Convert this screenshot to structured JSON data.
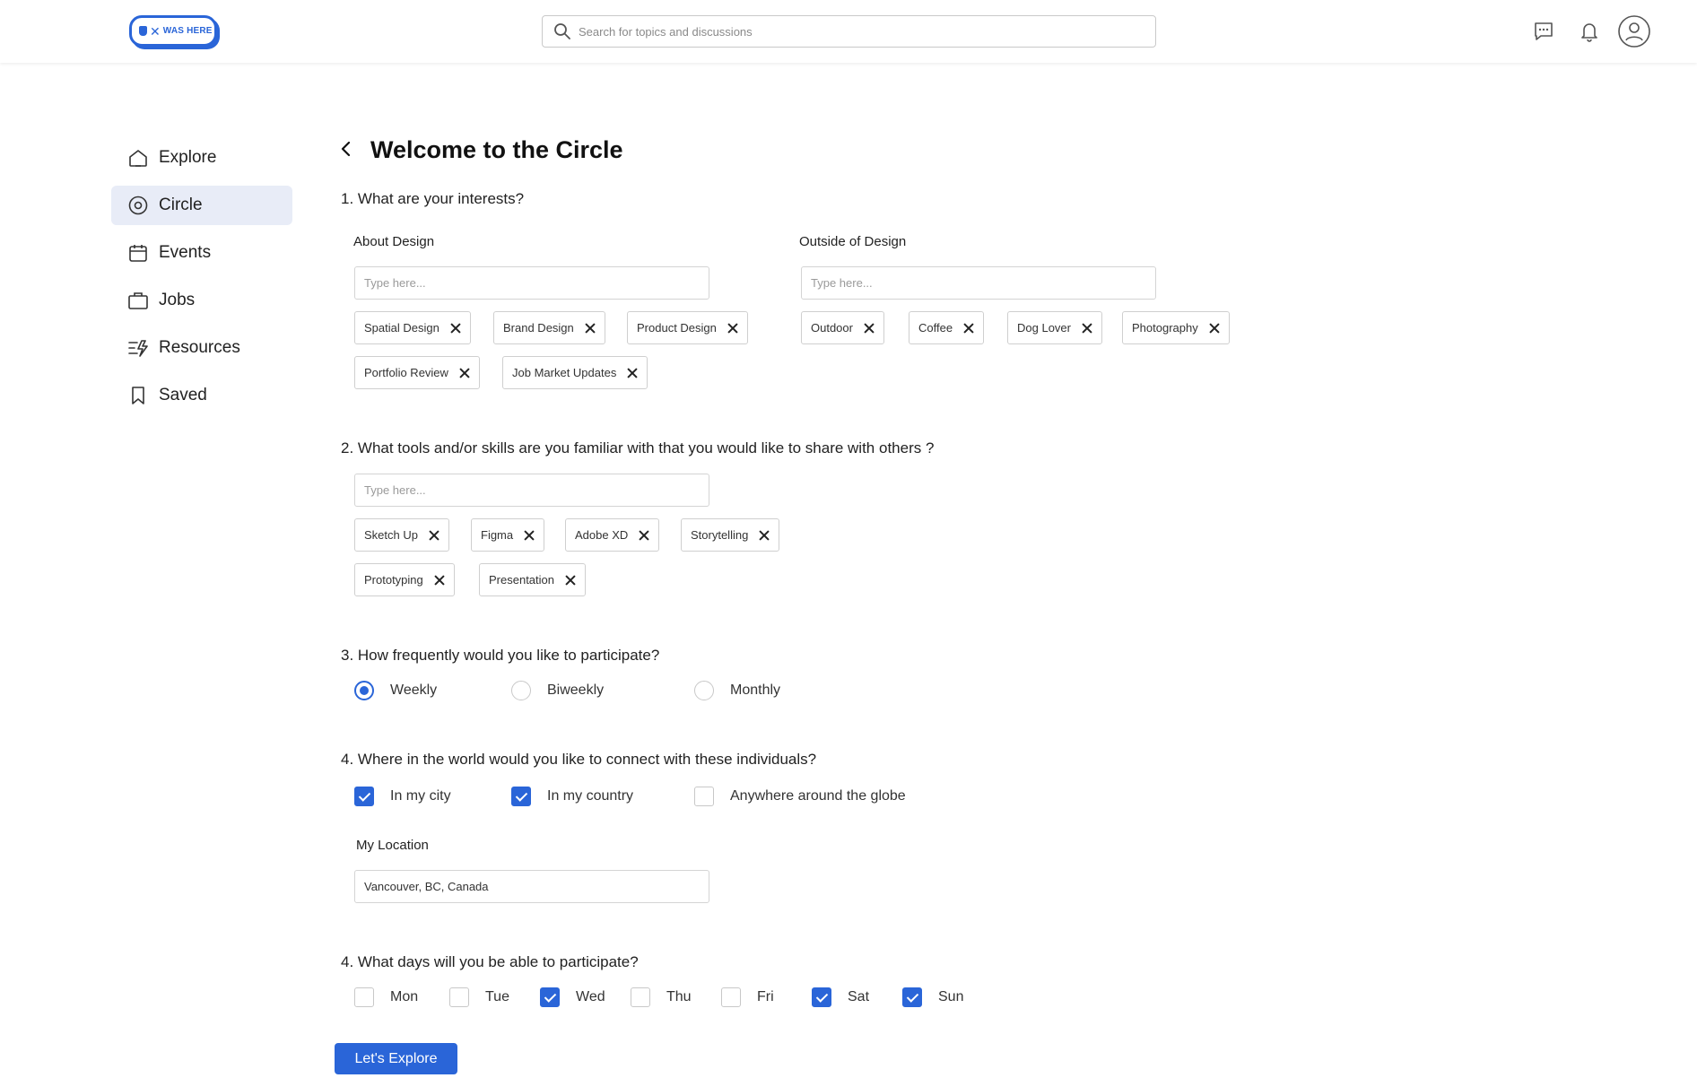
{
  "app": {
    "logo_text": "WAS HERE",
    "logo_mark": "UX",
    "accent": "#2a65d8"
  },
  "search": {
    "placeholder": "Search for topics and discussions",
    "icon": "search-icon"
  },
  "header_icons": [
    "chat-icon",
    "bell-icon",
    "user-icon"
  ],
  "sidebar": {
    "items": [
      {
        "label": "Explore",
        "icon": "home-icon",
        "active": false
      },
      {
        "label": "Circle",
        "icon": "circle-icon",
        "active": true
      },
      {
        "label": "Events",
        "icon": "calendar-icon",
        "active": false
      },
      {
        "label": "Jobs",
        "icon": "briefcase-icon",
        "active": false
      },
      {
        "label": "Resources",
        "icon": "resources-icon",
        "active": false
      },
      {
        "label": "Saved",
        "icon": "bookmark-icon",
        "active": false
      }
    ]
  },
  "page": {
    "title": "Welcome to the Circle"
  },
  "q1": {
    "question": "1. What are your interests?",
    "about": {
      "label": "About Design",
      "placeholder": "Type here...",
      "chips": [
        "Spatial Design",
        "Brand Design",
        "Product Design",
        "Portfolio Review",
        "Job Market Updates"
      ]
    },
    "outside": {
      "label": "Outside of Design",
      "placeholder": "Type here...",
      "chips": [
        "Outdoor",
        "Coffee",
        "Dog Lover",
        "Photography"
      ]
    }
  },
  "q2": {
    "question": "2. What tools and/or skills are you familiar with that you would like to share with others ?",
    "placeholder": "Type here...",
    "chips": [
      "Sketch Up",
      "Figma",
      "Adobe XD",
      "Storytelling",
      "Prototyping",
      "Presentation"
    ]
  },
  "q3": {
    "question": "3. How frequently would you like to participate?",
    "options": [
      {
        "label": "Weekly",
        "selected": true
      },
      {
        "label": "Biweekly",
        "selected": false
      },
      {
        "label": "Monthly",
        "selected": false
      }
    ]
  },
  "q4": {
    "question": "4. Where in the world would you like to connect with these individuals?",
    "options": [
      {
        "label": "In my city",
        "checked": true
      },
      {
        "label": "In my country",
        "checked": true
      },
      {
        "label": "Anywhere around the globe",
        "checked": false
      }
    ],
    "location_label": "My Location",
    "location_value": "Vancouver, BC, Canada"
  },
  "q5": {
    "question": "4. What days will you be able to participate?",
    "days": [
      {
        "label": "Mon",
        "checked": false
      },
      {
        "label": "Tue",
        "checked": false
      },
      {
        "label": "Wed",
        "checked": true
      },
      {
        "label": "Thu",
        "checked": false
      },
      {
        "label": "Fri",
        "checked": false
      },
      {
        "label": "Sat",
        "checked": true
      },
      {
        "label": "Sun",
        "checked": true
      }
    ]
  },
  "cta": {
    "label": "Let's Explore"
  }
}
